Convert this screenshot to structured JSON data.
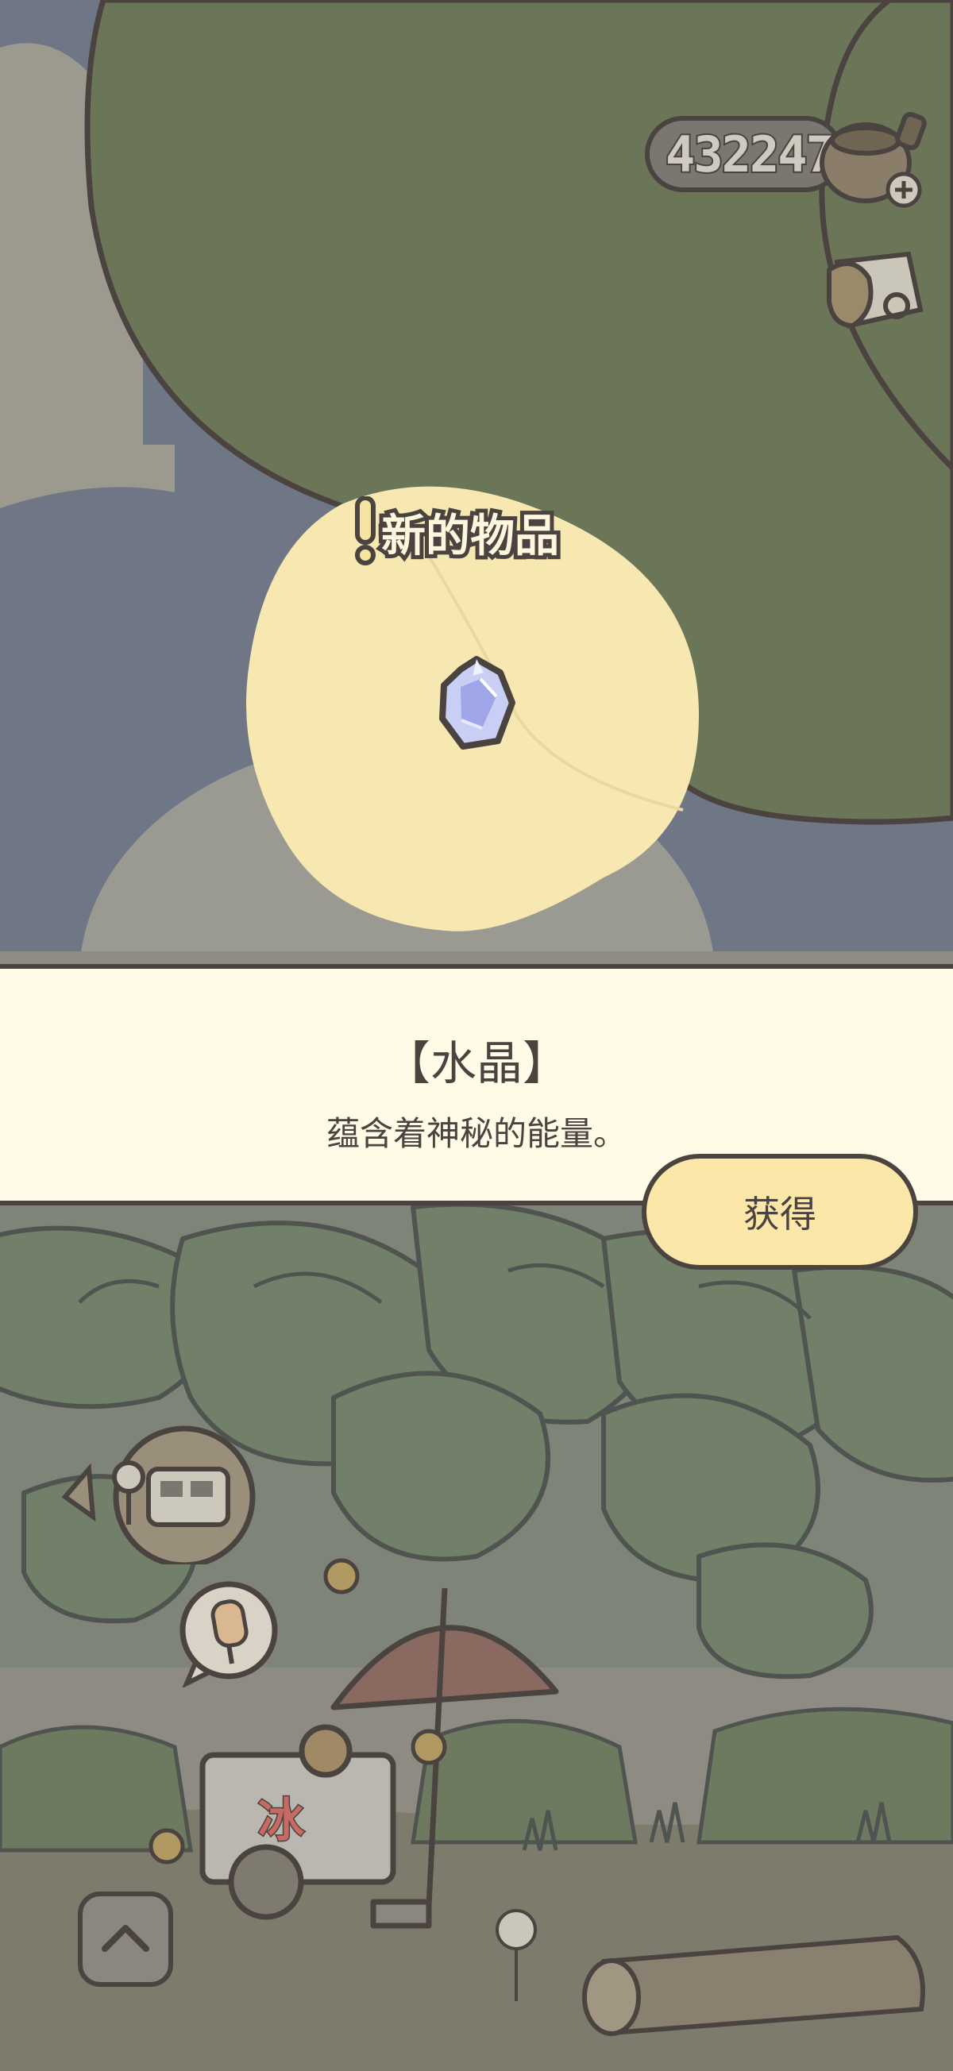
{
  "hud": {
    "clover_count": "432247",
    "icons": [
      "clover-pouch-icon",
      "add-icon",
      "bag-icon"
    ]
  },
  "popup": {
    "new_item_label": "新的物品",
    "item_name": "【水晶】",
    "item_description": "蕴含着神秘的能量。",
    "get_button_label": "获得"
  },
  "garden": {
    "cart_sign": "冰",
    "icons": [
      "train-ticket-icon",
      "popsicle-icon",
      "chevron-up-icon",
      "crystal-icon",
      "exclamation-icon"
    ]
  },
  "colors": {
    "outline": "#4a4340",
    "banner_bg": "#fffbe6",
    "button_bg": "#fbe8a9",
    "spotlight": "#f6e8b0",
    "leaf_dark": "#6b7558"
  }
}
